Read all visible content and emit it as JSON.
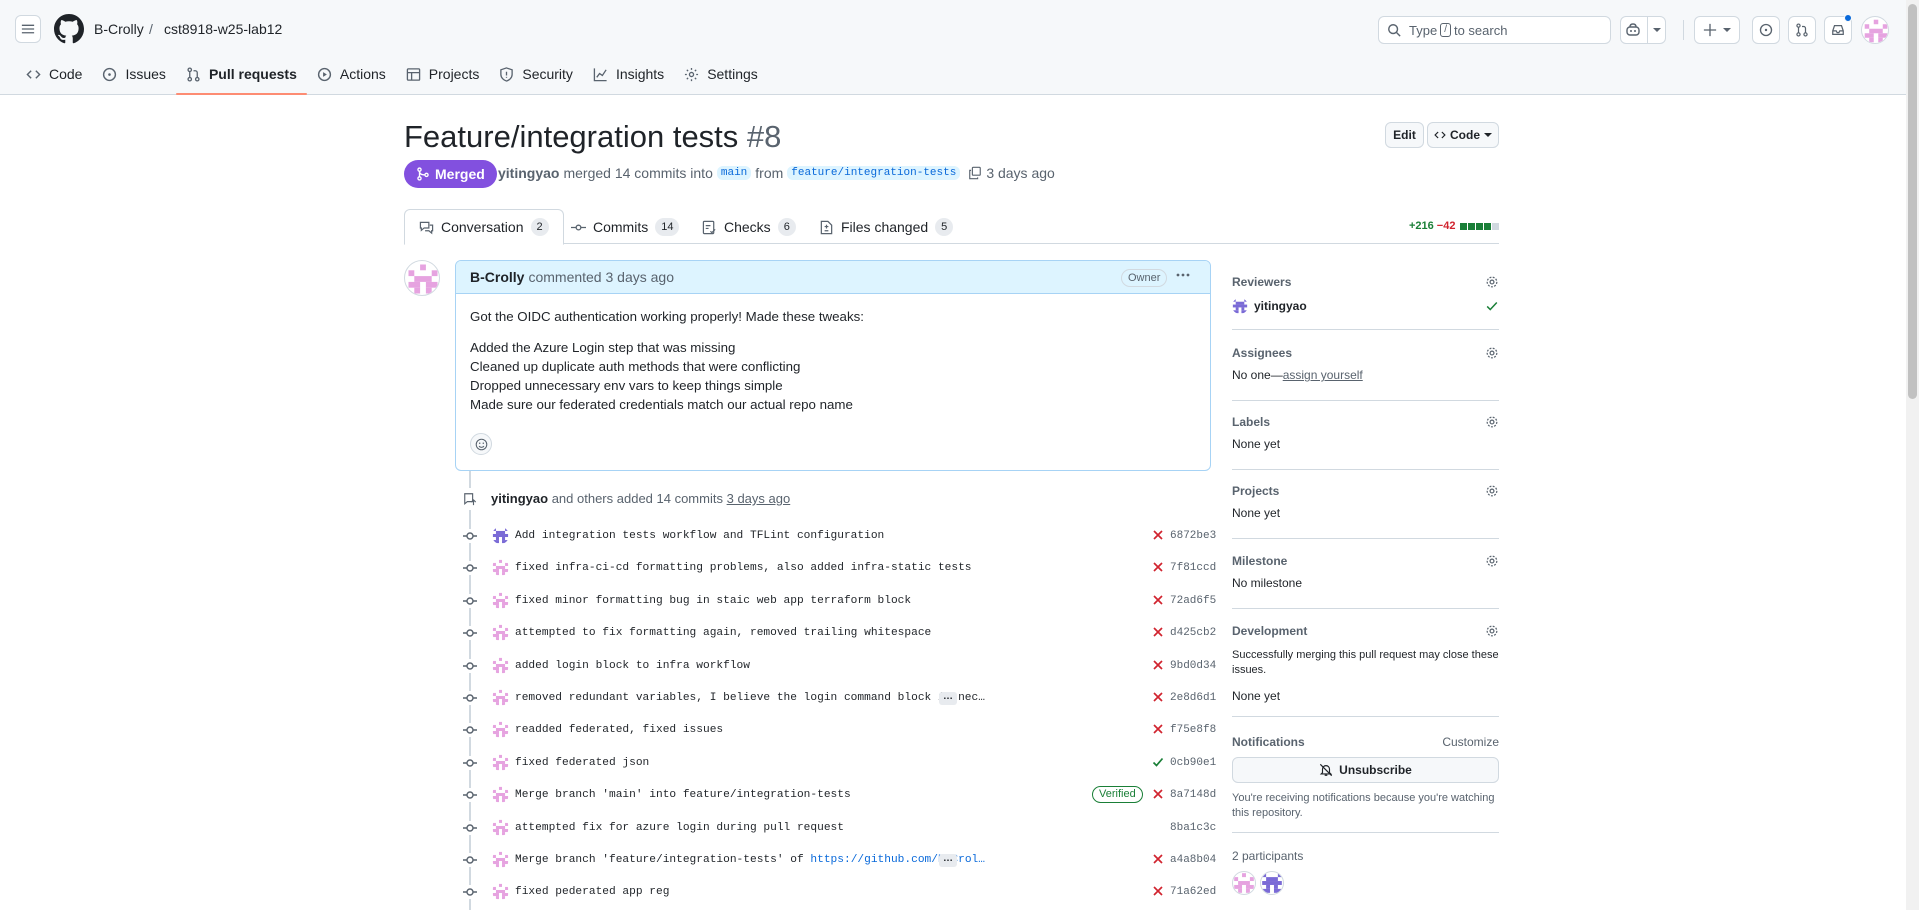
{
  "header": {
    "owner": "B-Crolly",
    "separator": "/",
    "repo": "cst8918-w25-lab12",
    "search_prefix": "Type",
    "search_key": "/",
    "search_suffix": "to search"
  },
  "repo_nav": [
    {
      "label": "Code",
      "icon": "code-icon"
    },
    {
      "label": "Issues",
      "icon": "issue-icon"
    },
    {
      "label": "Pull requests",
      "icon": "pull-request-icon",
      "active": true
    },
    {
      "label": "Actions",
      "icon": "play-icon"
    },
    {
      "label": "Projects",
      "icon": "table-icon"
    },
    {
      "label": "Security",
      "icon": "shield-icon"
    },
    {
      "label": "Insights",
      "icon": "graph-icon"
    },
    {
      "label": "Settings",
      "icon": "gear-icon"
    }
  ],
  "pr": {
    "title": "Feature/integration tests",
    "number": "#8",
    "edit_label": "Edit",
    "code_label": "Code",
    "state": "Merged",
    "author": "yitingyao",
    "merged_text": "merged 14 commits into",
    "base": "main",
    "from_text": "from",
    "head": "feature/integration-tests",
    "time": "3 days ago"
  },
  "tabs": [
    {
      "label": "Conversation",
      "count": "2",
      "icon": "comment-icon"
    },
    {
      "label": "Commits",
      "count": "14",
      "icon": "commit-icon"
    },
    {
      "label": "Checks",
      "count": "6",
      "icon": "checklist-icon"
    },
    {
      "label": "Files changed",
      "count": "5",
      "icon": "file-diff-icon"
    }
  ],
  "diffstat": {
    "additions": "+216",
    "deletions": "−42",
    "added_blocks": 4,
    "total_blocks": 5
  },
  "comment": {
    "author": "B-Crolly",
    "action": "commented 3 days ago",
    "badge": "Owner",
    "intro": "Got the OIDC authentication working properly! Made these tweaks:",
    "lines": [
      "Added the Azure Login step that was missing",
      "Cleaned up duplicate auth methods that were conflicting",
      "Dropped unnecessary env vars to keep things simple",
      "Made sure our federated credentials match our actual repo name"
    ]
  },
  "timeline": {
    "author": "yitingyao",
    "text": "and others added 14 commits",
    "time": "3 days ago"
  },
  "commits": [
    {
      "msg": "Add integration tests workflow and TFLint configuration",
      "sha": "6872be3",
      "status": "fail",
      "avatar": "purple"
    },
    {
      "msg": "fixed infra-ci-cd formatting problems, also added infra-static tests",
      "sha": "7f81ccd",
      "status": "fail",
      "avatar": "pink"
    },
    {
      "msg": "fixed minor formatting bug in staic web app terraform block",
      "sha": "72ad6f5",
      "status": "fail",
      "avatar": "pink"
    },
    {
      "msg": "attempted to fix formatting again, removed trailing whitespace",
      "sha": "d425cb2",
      "status": "fail",
      "avatar": "pink"
    },
    {
      "msg": "added login block to infra workflow",
      "sha": "9bd0d34",
      "status": "fail",
      "avatar": "pink"
    },
    {
      "msg": "removed redundant variables, I believe the login command block is nec…",
      "sha": "2e8d6d1",
      "status": "fail",
      "avatar": "pink",
      "more": true
    },
    {
      "msg": "readded federated, fixed issues",
      "sha": "f75e8f8",
      "status": "fail",
      "avatar": "pink"
    },
    {
      "msg": "fixed federated json",
      "sha": "0cb90e1",
      "status": "pass",
      "avatar": "pink"
    },
    {
      "msg": "Merge branch 'main' into feature/integration-tests",
      "sha": "8a7148d",
      "status": "fail",
      "avatar": "pink",
      "verified": "Verified"
    },
    {
      "msg": "attempted fix for azure login during pull request",
      "sha": "8ba1c3c",
      "status": "none",
      "avatar": "pink"
    },
    {
      "msg": "Merge branch 'feature/integration-tests' of ",
      "link": "https://github.com/B-Crol…",
      "sha": "a4a8b04",
      "status": "fail",
      "avatar": "pink",
      "more": true
    },
    {
      "msg": "fixed pederated app reg",
      "sha": "71a62ed",
      "status": "fail",
      "avatar": "pink"
    }
  ],
  "sidebar": {
    "reviewers": {
      "title": "Reviewers",
      "name": "yitingyao"
    },
    "assignees": {
      "title": "Assignees",
      "prefix": "No one—",
      "link": "assign yourself"
    },
    "labels": {
      "title": "Labels",
      "value": "None yet"
    },
    "projects": {
      "title": "Projects",
      "value": "None yet"
    },
    "milestone": {
      "title": "Milestone",
      "value": "No milestone"
    },
    "development": {
      "title": "Development",
      "desc": "Successfully merging this pull request may close these issues.",
      "value": "None yet"
    },
    "notifications": {
      "title": "Notifications",
      "customize": "Customize",
      "button": "Unsubscribe",
      "desc": "You're receiving notifications because you're watching this repository."
    },
    "participants": {
      "title": "2 participants"
    }
  },
  "colors": {
    "merged": "#8250df",
    "fail": "#d1242f",
    "pass": "#1a7f37",
    "link": "#0969da",
    "tab_underline": "#fd8c73"
  }
}
